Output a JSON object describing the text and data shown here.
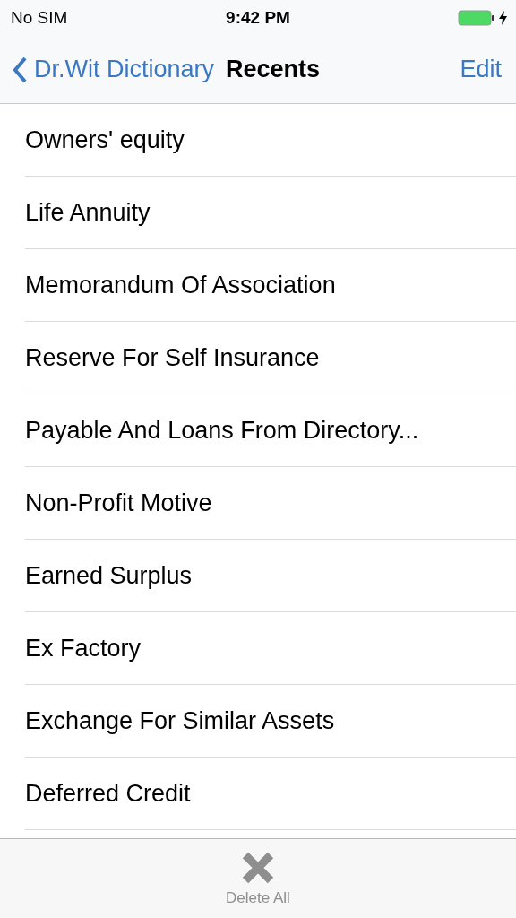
{
  "status_bar": {
    "carrier": "No SIM",
    "time": "9:42 PM"
  },
  "nav_bar": {
    "back": "Dr.Wit Dictionary",
    "title": "Recents",
    "action": "Edit"
  },
  "recents": [
    {
      "term": "Owners' equity"
    },
    {
      "term": "Life Annuity"
    },
    {
      "term": "Memorandum Of Association"
    },
    {
      "term": "Reserve For Self Insurance"
    },
    {
      "term": "Payable And Loans From Directory..."
    },
    {
      "term": "Non-Profit Motive"
    },
    {
      "term": "Earned Surplus"
    },
    {
      "term": "Ex Factory"
    },
    {
      "term": "Exchange For Similar Assets"
    },
    {
      "term": "Deferred Credit"
    }
  ],
  "toolbar": {
    "button": "Delete All",
    "disabled": true
  }
}
